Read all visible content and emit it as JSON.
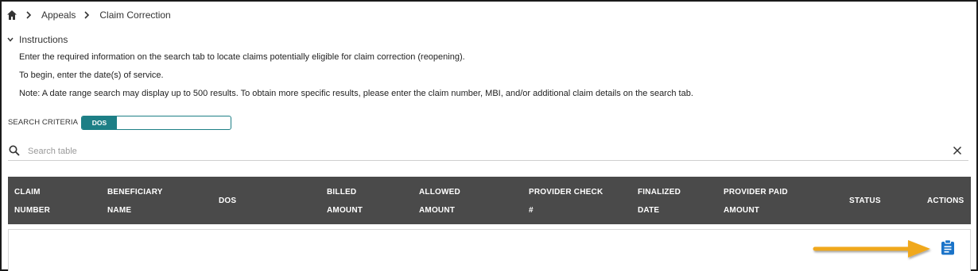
{
  "breadcrumb": {
    "home_icon": "home-icon",
    "items": [
      "Appeals",
      "Claim Correction"
    ]
  },
  "instructions": {
    "toggle_label": "Instructions",
    "lines": [
      "Enter the required information on the search tab to locate claims potentially eligible for claim correction (reopening).",
      "To begin, enter the date(s) of service.",
      "Note: A date range search may display up to 500 results. To obtain more specific results, please enter the claim number, MBI, and/or additional claim details on the search tab."
    ]
  },
  "search_criteria": {
    "label": "SEARCH CRITERIA",
    "selected": "DOS"
  },
  "search": {
    "placeholder": "Search table"
  },
  "table": {
    "columns": [
      {
        "line1": "CLAIM",
        "line2": "NUMBER"
      },
      {
        "line1": "BENEFICIARY",
        "line2": "NAME"
      },
      {
        "line1": "DOS",
        "line2": ""
      },
      {
        "line1": "BILLED",
        "line2": "AMOUNT"
      },
      {
        "line1": "ALLOWED",
        "line2": "AMOUNT"
      },
      {
        "line1": "PROVIDER CHECK",
        "line2": "#"
      },
      {
        "line1": "FINALIZED",
        "line2": "DATE"
      },
      {
        "line1": "PROVIDER PAID",
        "line2": "AMOUNT"
      },
      {
        "line1": "STATUS",
        "line2": ""
      },
      {
        "line1": "ACTIONS",
        "line2": ""
      }
    ]
  },
  "colors": {
    "accent_teal": "#1d7f86",
    "header_bg": "#4a4a4a",
    "action_icon": "#1a73c8",
    "annotation_arrow": "#f0a81e"
  }
}
